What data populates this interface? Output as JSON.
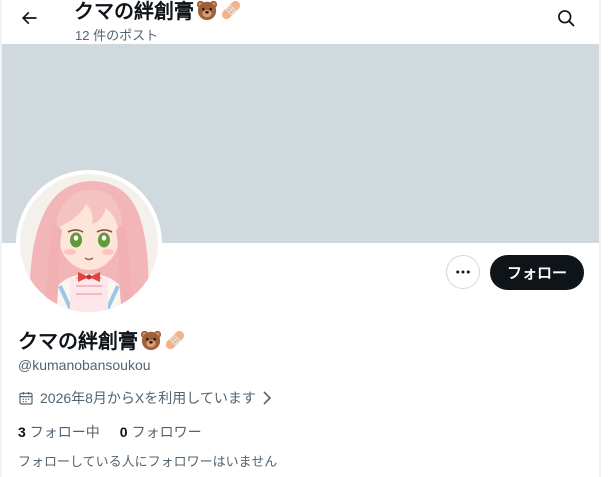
{
  "header": {
    "title": "クマの絆創膏",
    "post_count": "12 件のポスト"
  },
  "profile": {
    "display_name": "クマの絆創膏",
    "handle": "@kumanobansoukou",
    "joined": "2026年8月からXを利用しています",
    "following_count": "3",
    "following_label": "フォロー中",
    "followers_count": "0",
    "followers_label": "フォロワー",
    "no_mutuals_note": "フォローしている人にフォロワーはいません"
  },
  "actions": {
    "follow_label": "フォロー"
  },
  "colors": {
    "banner": "#cfd9de",
    "follow_button": "#0f1419",
    "secondary_text": "#536471"
  },
  "icons": [
    "back-arrow-icon",
    "search-icon",
    "more-options-icon",
    "calendar-icon",
    "chevron-right-icon",
    "bear-emoji",
    "bandage-emoji"
  ]
}
